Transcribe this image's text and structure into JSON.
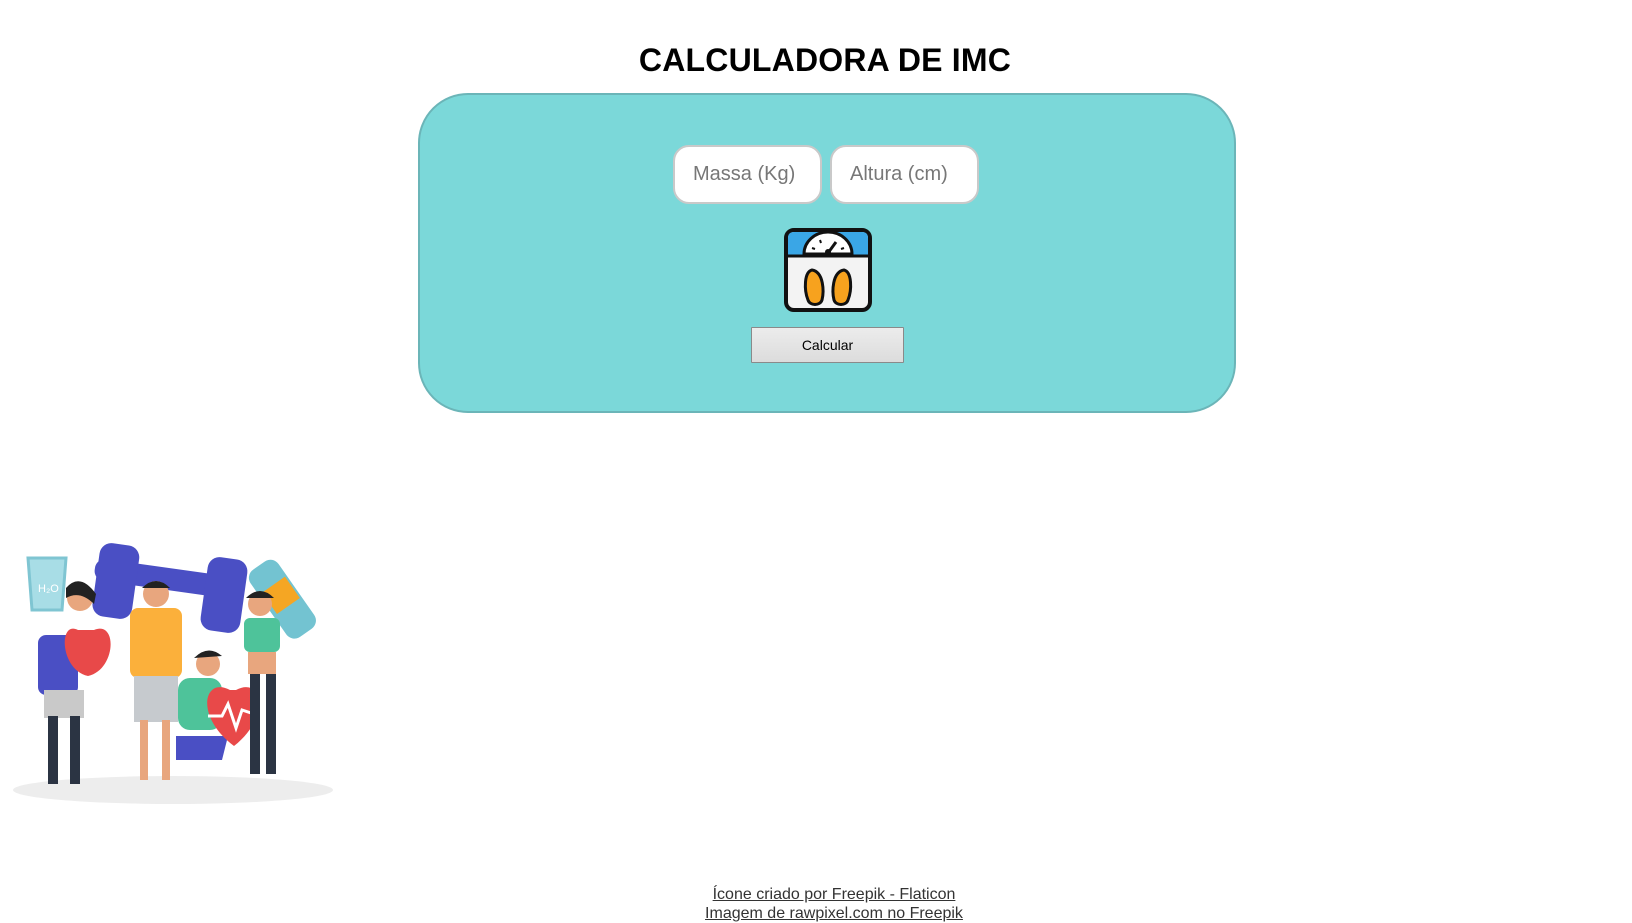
{
  "header": {
    "title": "CALCULADORA DE IMC"
  },
  "form": {
    "mass_placeholder": "Massa (Kg)",
    "height_placeholder": "Altura (cm)",
    "calculate_label": "Calcular",
    "scale_icon": "bathroom-scale-icon"
  },
  "illustration": {
    "icon": "fitness-people-illustration",
    "bottle_text": "H₂O"
  },
  "footer": {
    "icon_credit": "Ícone criado por Freepik - Flaticon",
    "image_credit": "Imagem de rawpixel.com no Freepik"
  },
  "colors": {
    "panel": "#7bd8d9",
    "panel_border": "#6bb5b8"
  }
}
